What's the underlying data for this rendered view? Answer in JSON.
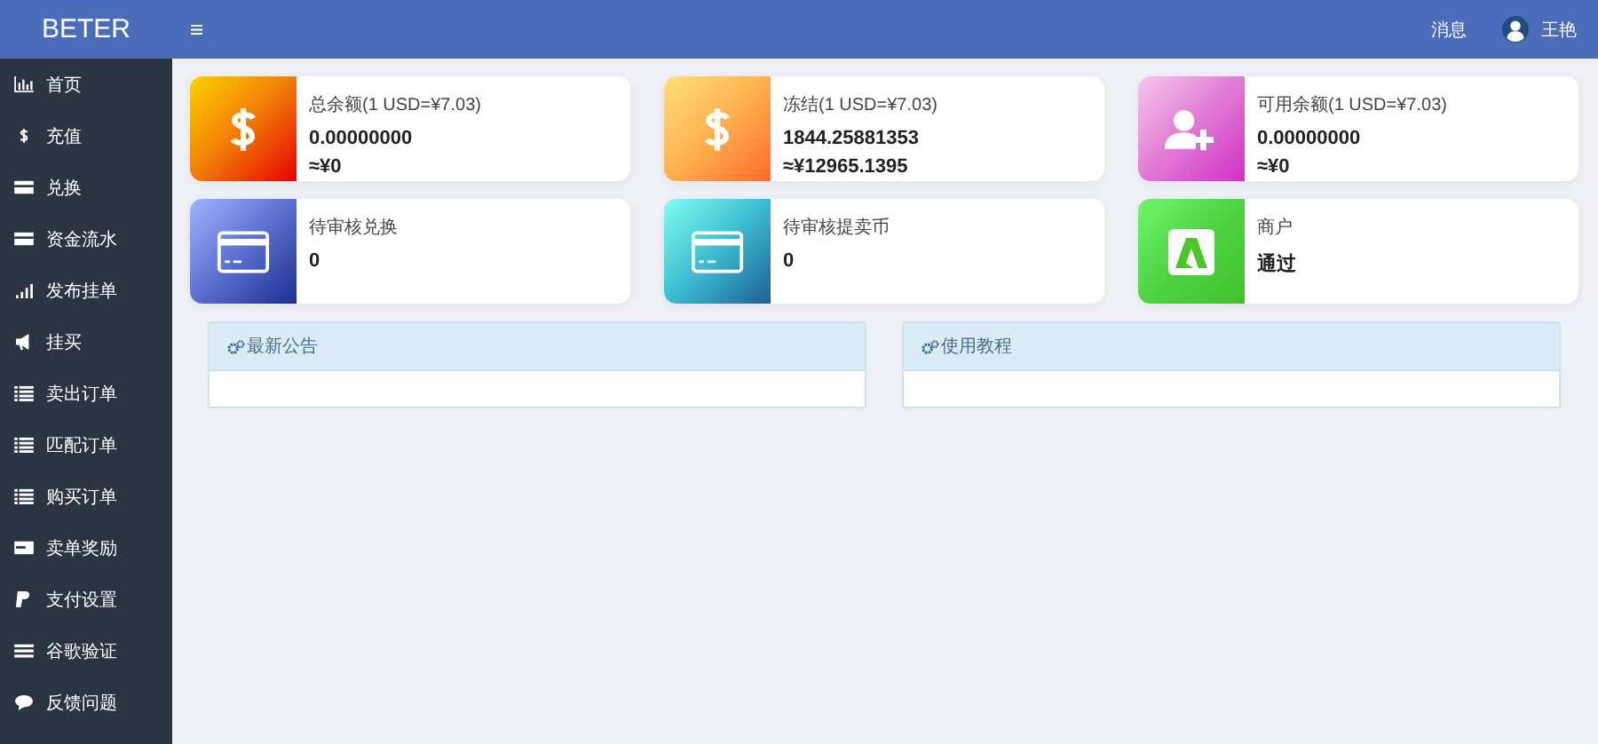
{
  "brand": "BETER",
  "header": {
    "menu_glyph": "≡",
    "messages": "消息",
    "user": "王艳"
  },
  "sidebar": {
    "items": [
      {
        "label": "首页",
        "kind": "chart"
      },
      {
        "label": "充值",
        "kind": "dollar"
      },
      {
        "label": "兑换",
        "kind": "card"
      },
      {
        "label": "资金流水",
        "kind": "card"
      },
      {
        "label": "发布挂单",
        "kind": "signal"
      },
      {
        "label": "挂买",
        "kind": "megaphone"
      },
      {
        "label": "卖出订单",
        "kind": "list"
      },
      {
        "label": "匹配订单",
        "kind": "list"
      },
      {
        "label": "购买订单",
        "kind": "list"
      },
      {
        "label": "卖单奖励",
        "kind": "card2"
      },
      {
        "label": "支付设置",
        "kind": "paypal"
      },
      {
        "label": "谷歌验证",
        "kind": "bars"
      },
      {
        "label": "反馈问题",
        "kind": "chat"
      }
    ]
  },
  "cards": [
    {
      "title": "总余额(1 USD=¥7.03)",
      "value": "0.00000000",
      "sub": "≈¥0",
      "kind": "dollar"
    },
    {
      "title": "冻结(1 USD=¥7.03)",
      "value": "1844.25881353",
      "sub": "≈¥12965.1395",
      "kind": "dollar"
    },
    {
      "title": "可用余额(1 USD=¥7.03)",
      "value": "0.00000000",
      "sub": "≈¥0",
      "kind": "user-plus"
    },
    {
      "title": "待审核兑换",
      "value": "0",
      "kind": "card"
    },
    {
      "title": "待审核提卖币",
      "value": "0",
      "kind": "card"
    },
    {
      "title": "商户",
      "value": "通过",
      "kind": "app"
    }
  ],
  "panels": [
    {
      "title": "最新公告"
    },
    {
      "title": "使用教程"
    }
  ]
}
